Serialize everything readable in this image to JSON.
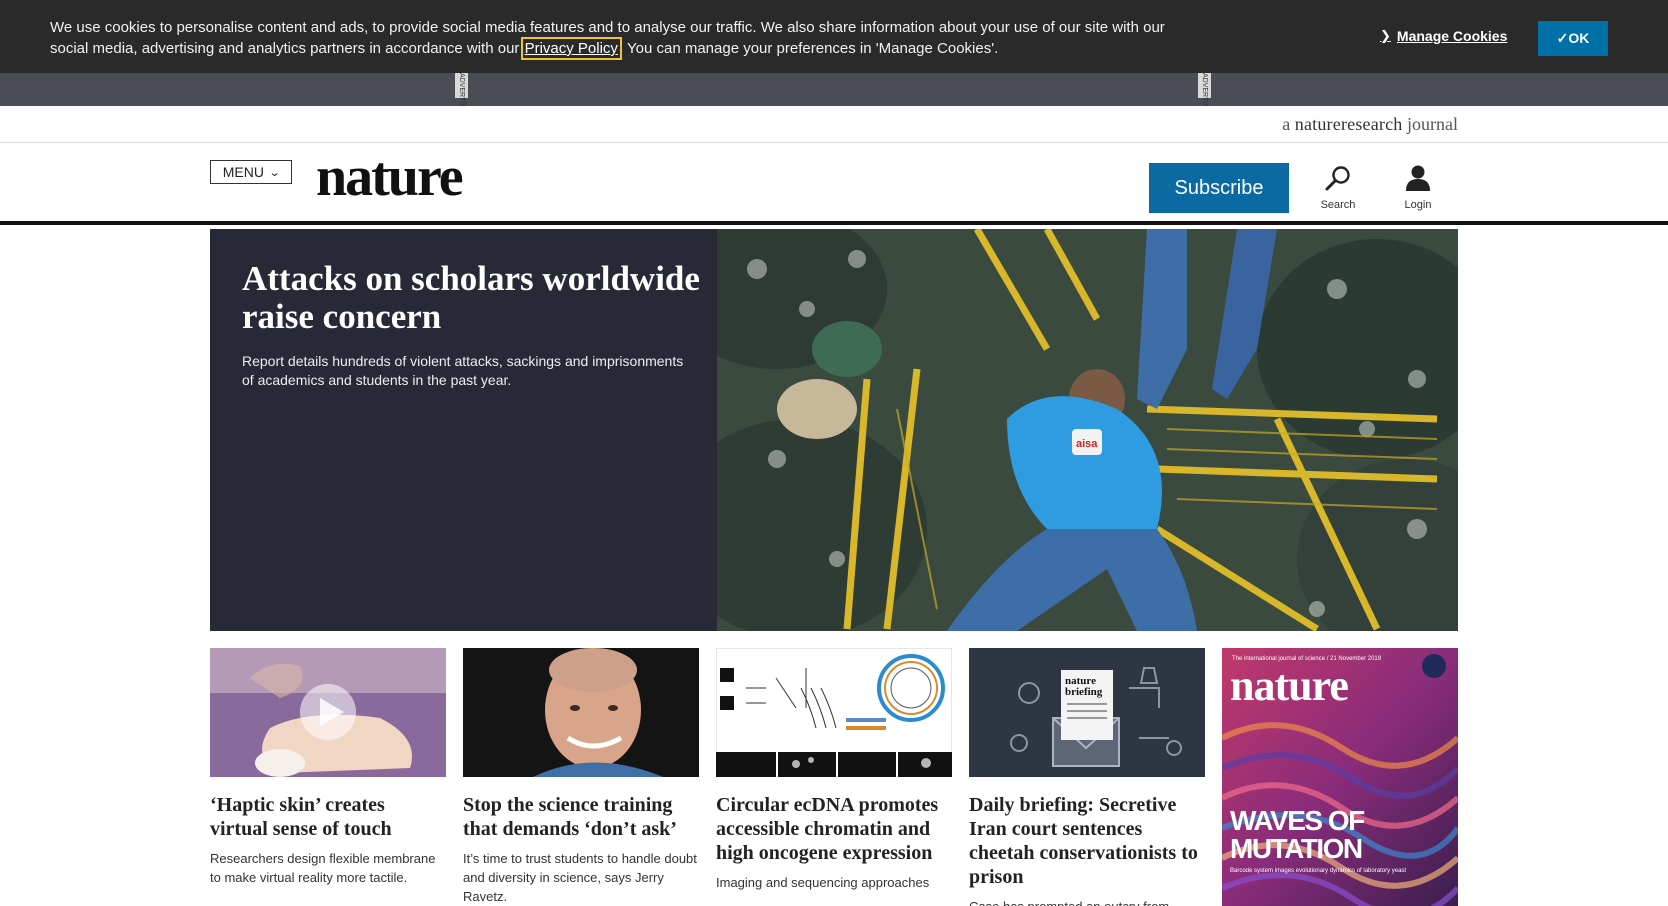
{
  "cookie_banner": {
    "text_before": "We use cookies to personalise content and ads, to provide social media features and to analyse our traffic. We also share information about your use of our site with our social media, advertising and analytics partners in accordance with our ",
    "privacy_link": "Privacy Policy",
    "text_after": ". You can manage your preferences in 'Manage Cookies'.",
    "manage_label": "Manage Cookies",
    "ok_label": "✓OK"
  },
  "ad_strip": {
    "tag_left": "ADVERTISEMENT",
    "tag_right": "ADVERTISEMENT"
  },
  "research_bar": {
    "prefix": "a ",
    "brand": "natureresearch",
    "suffix": " journal"
  },
  "header": {
    "menu_label": "MENU",
    "logo": "nature",
    "subscribe_label": "Subscribe",
    "search_label": "Search",
    "login_label": "Login"
  },
  "hero": {
    "title": "Attacks on scholars worldwide raise concern",
    "summary": "Report details hundreds of violent attacks, sackings and imprisonments of academics and students in the past year.",
    "image_alt": "aisa"
  },
  "cards": [
    {
      "title": "‘Haptic skin’ creates virtual sense of touch",
      "summary": "Researchers design flexible membrane to make virtual reality more tactile."
    },
    {
      "title": "Stop the science training that demands ‘don’t ask’",
      "summary": "It’s time to trust students to handle doubt and diversity in science, says Jerry Ravetz."
    },
    {
      "title": "Circular ecDNA promotes accessible chromatin and high oncogene expression",
      "summary": "Imaging and sequencing approaches"
    },
    {
      "title": "Daily briefing: Secretive Iran court sentences cheetah conservationists to prison",
      "summary": "Case has prompted an outcry from"
    }
  ],
  "briefing_logo": {
    "line1": "nature",
    "line2": "briefing"
  },
  "cover": {
    "masthead": "nature",
    "topline": "The international journal of science / 21 November 2019",
    "headline_1": "WAVES OF",
    "headline_2": "MUTATION",
    "deck": "Barcode system images evolutionary dynamics of laboratory yeast"
  },
  "colors": {
    "banner": "#2a2a2a",
    "ok": "#0070a8",
    "subscribe": "#0a6aa1",
    "hero_panel": "#272a36"
  }
}
